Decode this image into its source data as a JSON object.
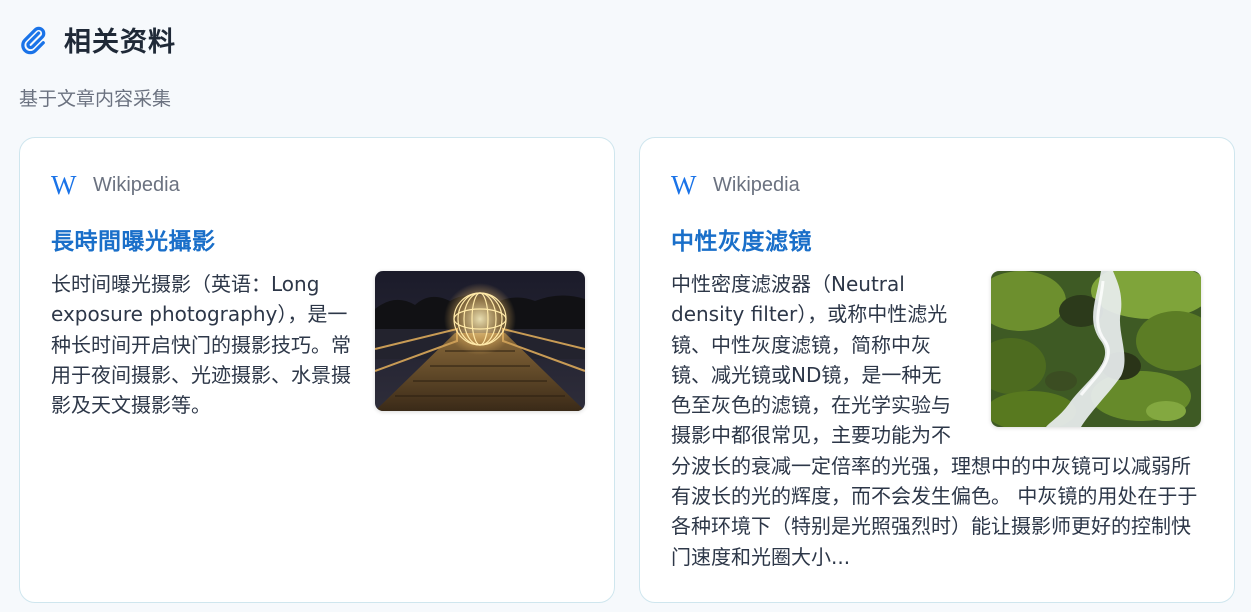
{
  "header": {
    "icon": "paperclip-icon",
    "title": "相关资料",
    "subtitle": "基于文章内容采集"
  },
  "colors": {
    "accent": "#1a73e8",
    "title_link": "#1a6fc9",
    "card_border": "#cfe6ee",
    "background": "#f6f9fc"
  },
  "cards": [
    {
      "source_icon": "wikipedia-icon",
      "source_name": "Wikipedia",
      "title": "長時間曝光攝影",
      "text": "长时间曝光摄影（英语：Long exposure photography），是一种长时间开启快门的摄影技巧。常用于夜间摄影、光迹摄影、水景摄影及天文摄影等。",
      "image": "light-orb-on-pier-photo"
    },
    {
      "source_icon": "wikipedia-icon",
      "source_name": "Wikipedia",
      "title": "中性灰度滤镜",
      "text": "中性密度滤波器（Neutral density filter），或称中性滤光镜、中性灰度滤镜，简称中灰镜、减光镜或ND镜，是一种无色至灰色的滤镜，在光学实验与摄影中都很常见，主要功能为不分波长的衰减一定倍率的光强，理想中的中灰镜可以减弱所有波长的光的辉度，而不会发生偏色。 中灰镜的用处在于于各种环境下（特别是光照强烈时）能让摄影师更好的控制快门速度和光圈大小...",
      "image": "mossy-waterfall-photo"
    }
  ]
}
